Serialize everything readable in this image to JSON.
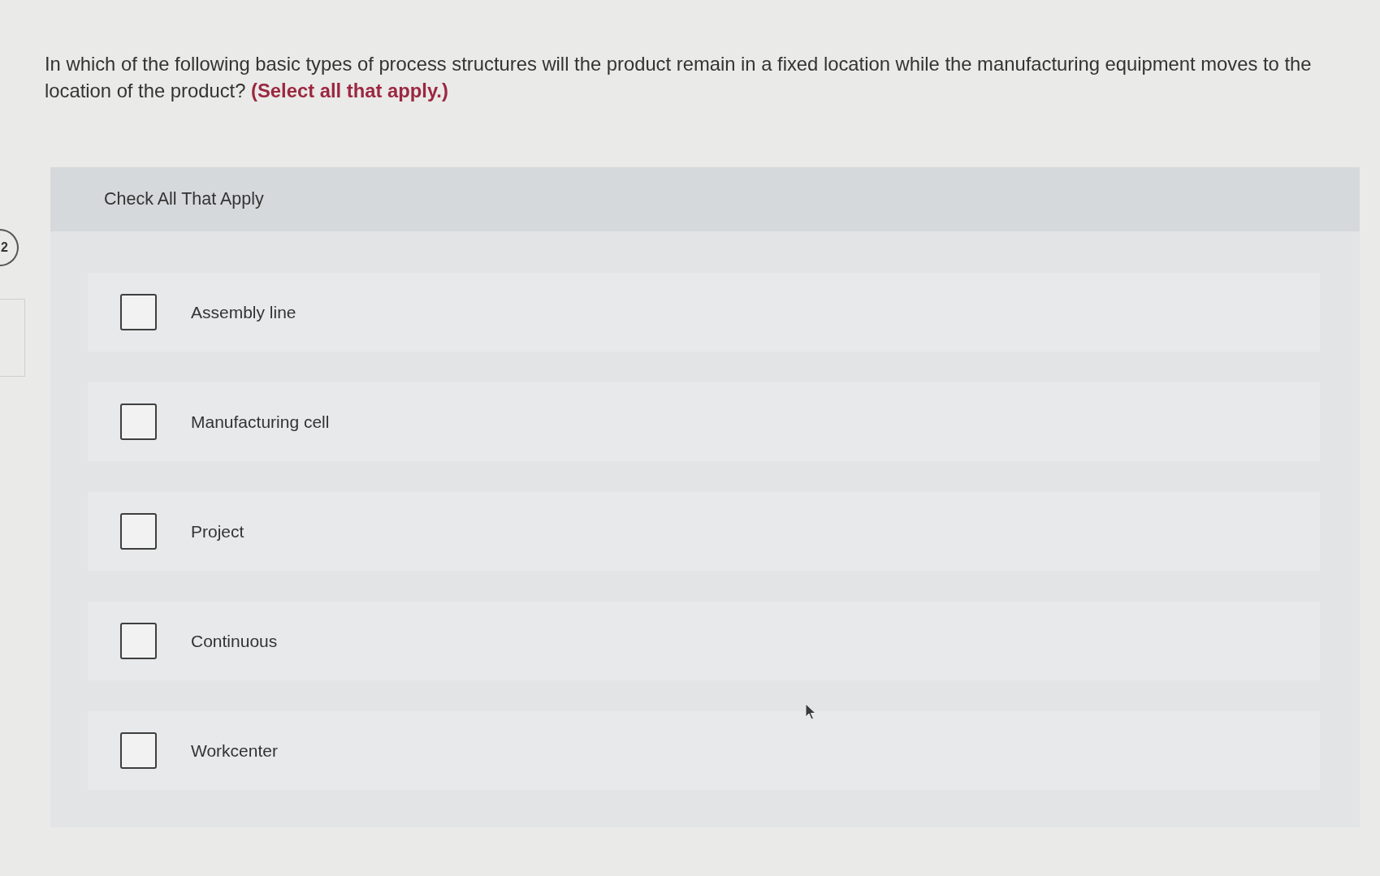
{
  "question": {
    "number": "2",
    "text": "In which of the following basic types of process structures will the product remain in a fixed location while the manufacturing equipment moves to the location of the product? **(Select all that apply.)**"
  },
  "answer_panel": {
    "header": "Check All That Apply",
    "options": [
      {
        "label": "Assembly line",
        "checked": false
      },
      {
        "label": "Manufacturing cell",
        "checked": false
      },
      {
        "label": "Project",
        "checked": false
      },
      {
        "label": "Continuous",
        "checked": false
      },
      {
        "label": "Workcenter",
        "checked": false
      }
    ]
  }
}
